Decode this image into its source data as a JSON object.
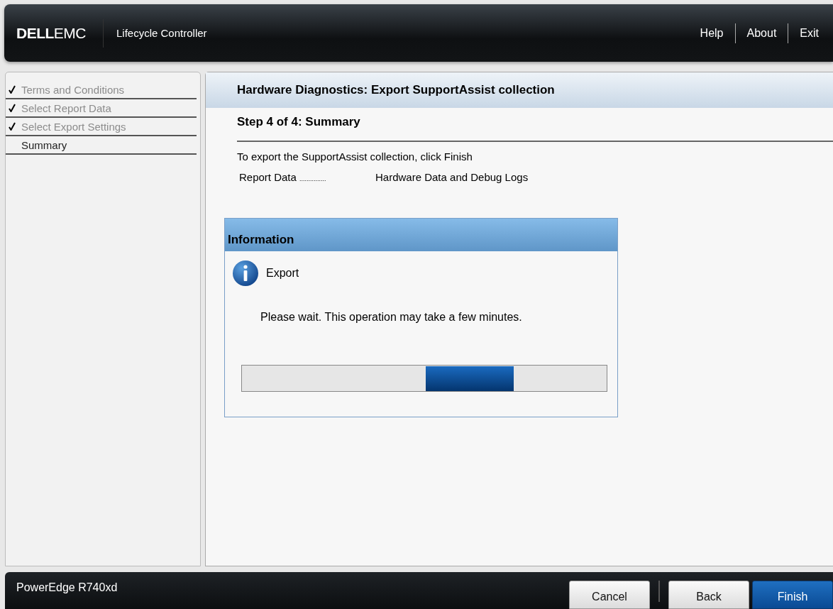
{
  "header": {
    "logo_bold": "DELL",
    "logo_light": "EMC",
    "product": "Lifecycle Controller",
    "links": [
      "Help",
      "About",
      "Exit"
    ]
  },
  "steps": [
    {
      "label": "Terms and Conditions",
      "done": true
    },
    {
      "label": "Select Report Data",
      "done": true
    },
    {
      "label": "Select Export Settings",
      "done": true
    },
    {
      "label": "Summary",
      "done": false
    }
  ],
  "main": {
    "title": "Hardware Diagnostics: Export SupportAssist collection",
    "step_title": "Step 4 of 4: Summary",
    "instruction": "To export the SupportAssist collection, click Finish",
    "fields": [
      {
        "label": "Report Data",
        "dots": "...............",
        "value": "Hardware Data and Debug Logs"
      }
    ]
  },
  "dialog": {
    "title": "Information",
    "heading": "Export",
    "message": "Please wait. This operation may take a few minutes.",
    "busy": true
  },
  "footer": {
    "model": "PowerEdge R740xd",
    "buttons": [
      {
        "label": "Cancel",
        "primary": false
      },
      {
        "label": "Back",
        "primary": false
      },
      {
        "label": "Finish",
        "primary": true
      }
    ]
  }
}
